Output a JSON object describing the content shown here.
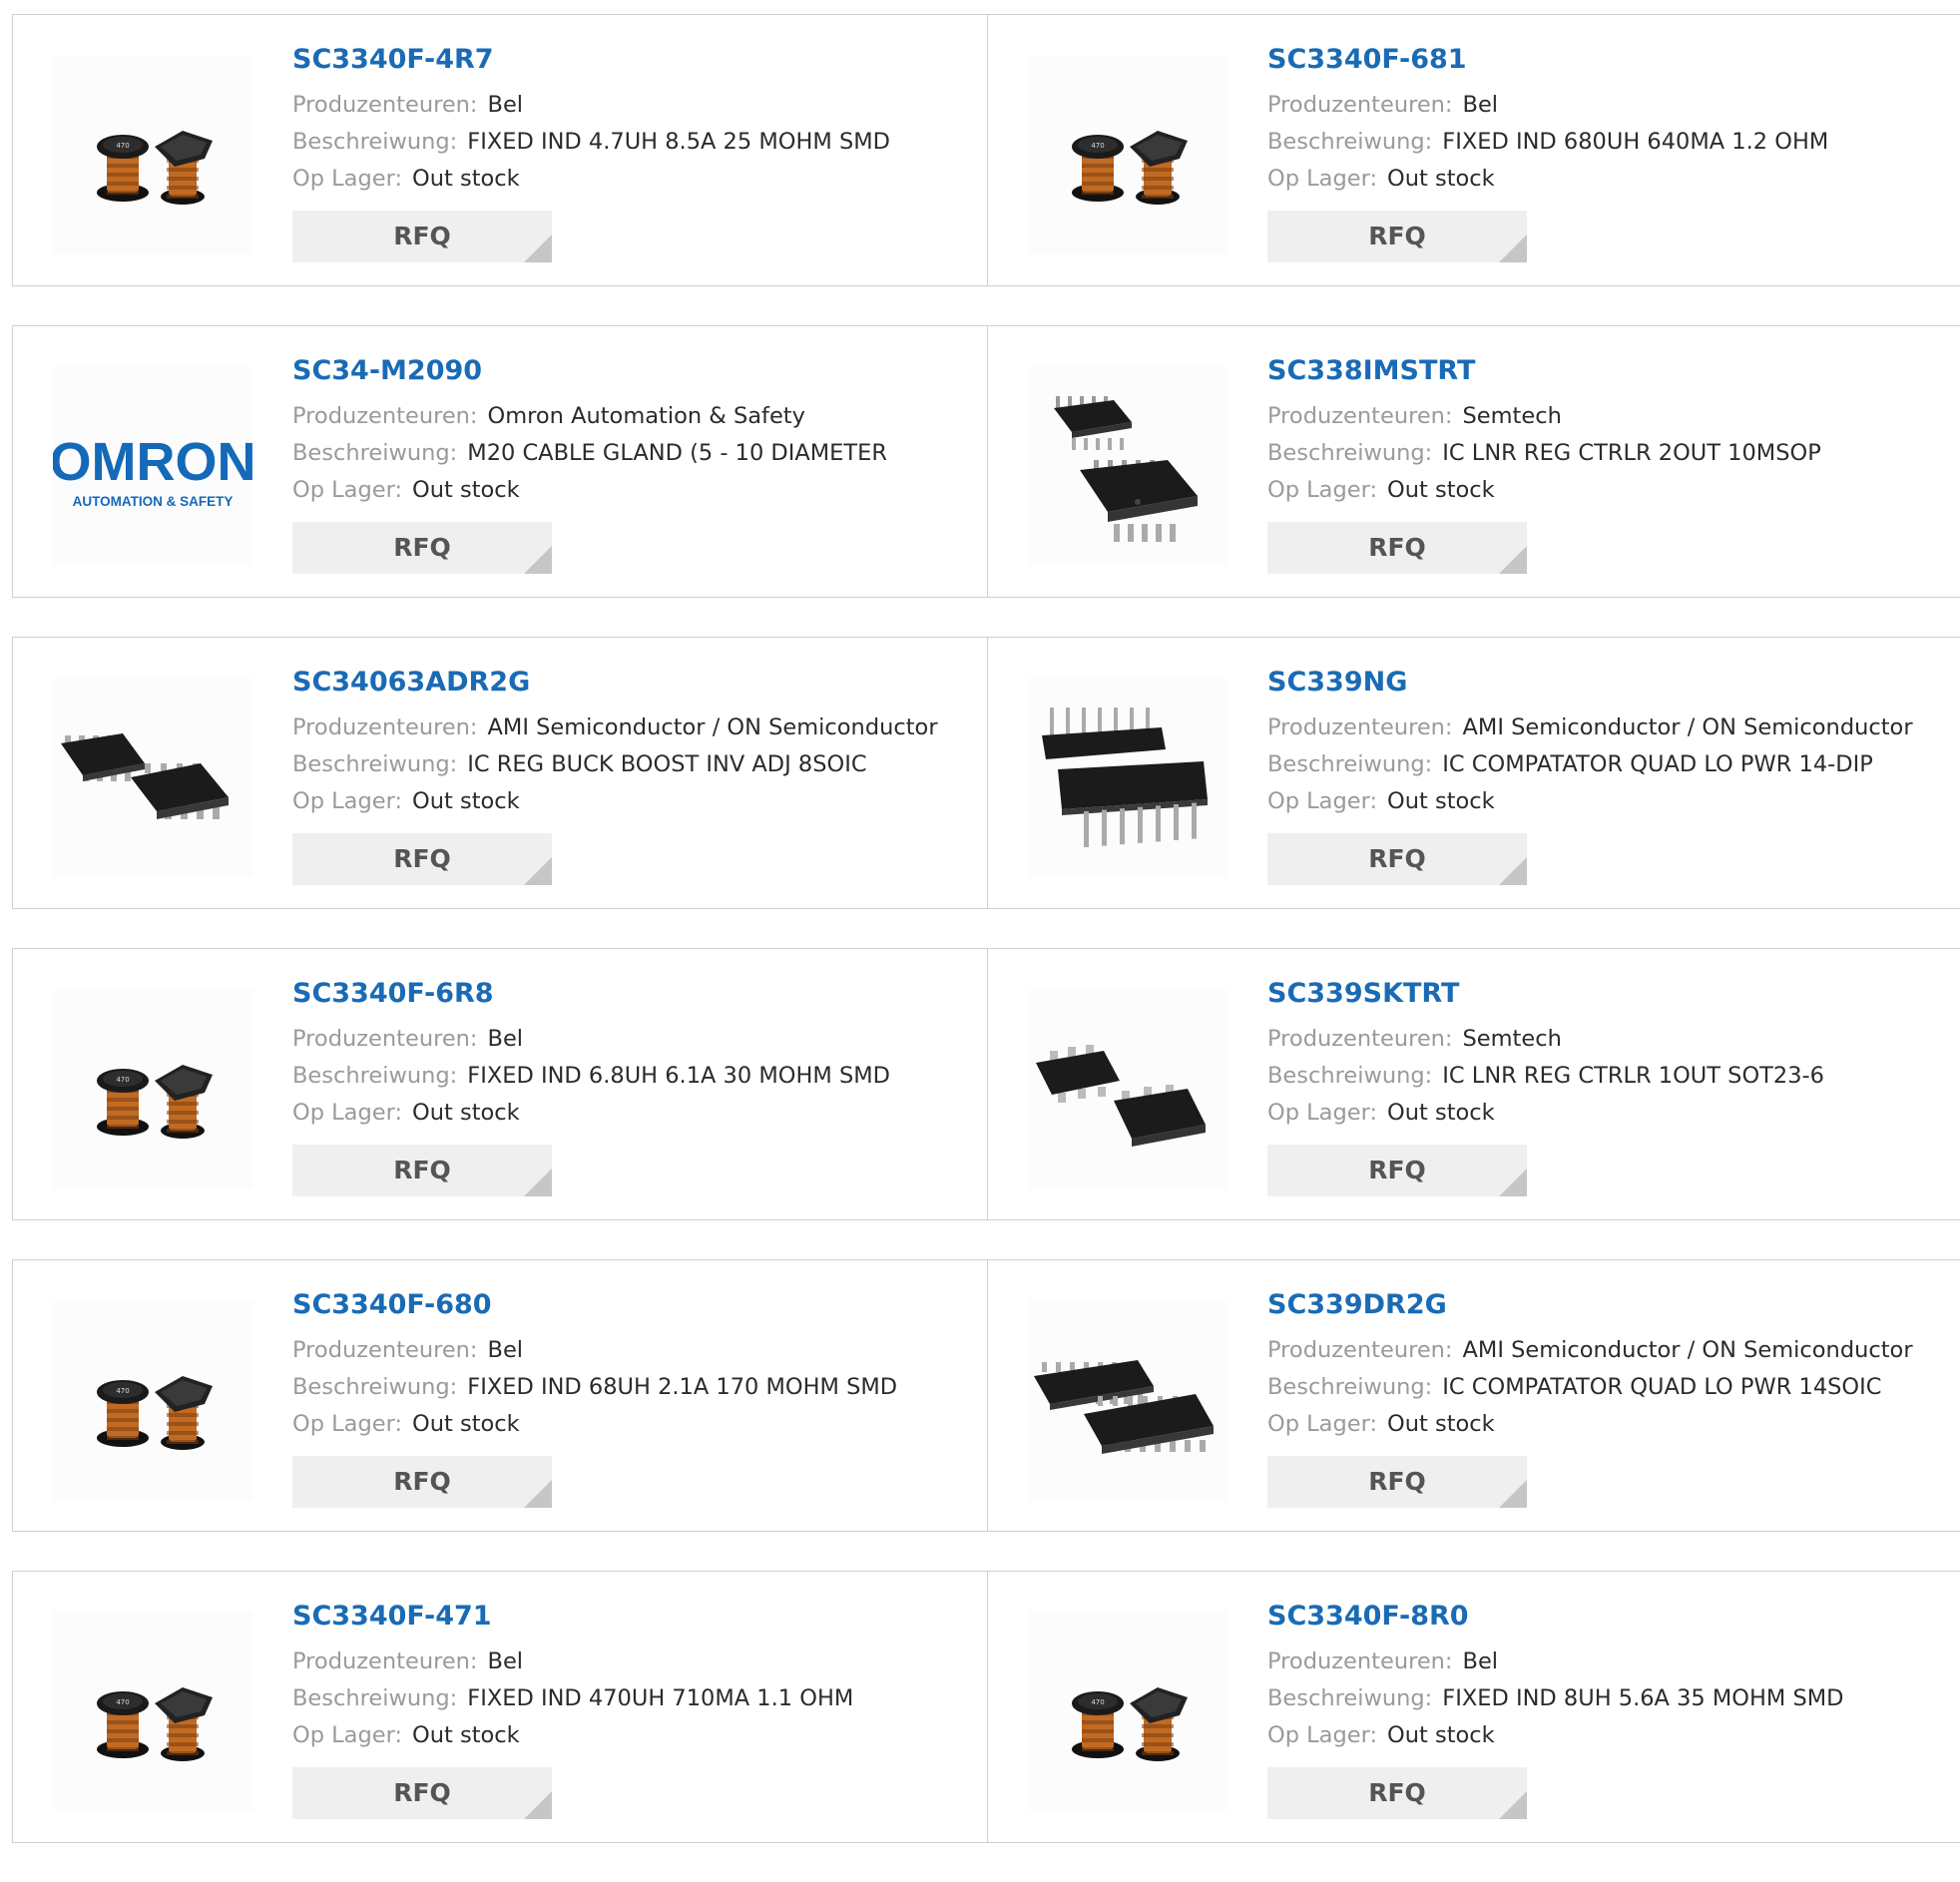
{
  "labels": {
    "manufacturer": "Produzenteuren:",
    "description": "Beschreiwung:",
    "stock": "Op Lager:",
    "rfq": "RFQ"
  },
  "products": [
    {
      "part": "SC3340F-4R7",
      "manufacturer": "Bel",
      "description": "FIXED IND 4.7UH 8.5A 25 MOHM SMD",
      "stock": "Out stock",
      "image": "inductor-image"
    },
    {
      "part": "SC3340F-681",
      "manufacturer": "Bel",
      "description": "FIXED IND 680UH 640MA 1.2 OHM",
      "stock": "Out stock",
      "image": "inductor-image"
    },
    {
      "part": "SC34-M2090",
      "manufacturer": "Omron Automation & Safety",
      "description": "M20 CABLE GLAND (5 - 10 DIAMETER",
      "stock": "Out stock",
      "image": "omron-logo"
    },
    {
      "part": "SC338IMSTRT",
      "manufacturer": "Semtech",
      "description": "IC LNR REG CTRLR 2OUT 10MSOP",
      "stock": "Out stock",
      "image": "msop-chip-image"
    },
    {
      "part": "SC34063ADR2G",
      "manufacturer": "AMI Semiconductor / ON Semiconductor",
      "description": "IC REG BUCK BOOST INV ADJ 8SOIC",
      "stock": "Out stock",
      "image": "soic8-chip-image"
    },
    {
      "part": "SC339NG",
      "manufacturer": "AMI Semiconductor / ON Semiconductor",
      "description": "IC COMPATATOR QUAD LO PWR 14-DIP",
      "stock": "Out stock",
      "image": "dip14-chip-image"
    },
    {
      "part": "SC3340F-6R8",
      "manufacturer": "Bel",
      "description": "FIXED IND 6.8UH 6.1A 30 MOHM SMD",
      "stock": "Out stock",
      "image": "inductor-image"
    },
    {
      "part": "SC339SKTRT",
      "manufacturer": "Semtech",
      "description": "IC LNR REG CTRLR 1OUT SOT23-6",
      "stock": "Out stock",
      "image": "sot23-chip-image"
    },
    {
      "part": "SC3340F-680",
      "manufacturer": "Bel",
      "description": "FIXED IND 68UH 2.1A 170 MOHM SMD",
      "stock": "Out stock",
      "image": "inductor-image"
    },
    {
      "part": "SC339DR2G",
      "manufacturer": "AMI Semiconductor / ON Semiconductor",
      "description": "IC COMPATATOR QUAD LO PWR 14SOIC",
      "stock": "Out stock",
      "image": "soic14-chip-image"
    },
    {
      "part": "SC3340F-471",
      "manufacturer": "Bel",
      "description": "FIXED IND 470UH 710MA 1.1 OHM",
      "stock": "Out stock",
      "image": "inductor-image"
    },
    {
      "part": "SC3340F-8R0",
      "manufacturer": "Bel",
      "description": "FIXED IND 8UH 5.6A 35 MOHM SMD",
      "stock": "Out stock",
      "image": "inductor-image"
    }
  ],
  "logo_text": {
    "brand": "OMRON",
    "tagline": "AUTOMATION & SAFETY"
  },
  "inductor_marking": "470",
  "colors": {
    "link": "#1a6bb5",
    "label": "#9a9a9a",
    "value": "#2b2b2b",
    "button_bg": "#efefef",
    "border": "#cfcfcf",
    "omron_blue": "#1469b8"
  }
}
